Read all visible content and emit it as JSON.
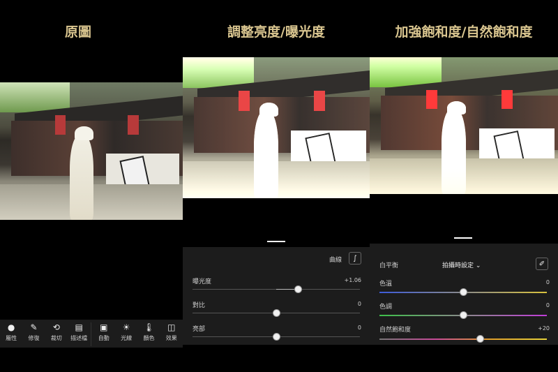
{
  "panels": [
    {
      "title": "原圖"
    },
    {
      "title": "調整亮度/曝光度"
    },
    {
      "title": "加強飽和度/自然飽和度"
    }
  ],
  "toolbar": {
    "items": [
      {
        "label": "屬性",
        "icon": "preset-icon"
      },
      {
        "label": "修復",
        "icon": "heal-icon"
      },
      {
        "label": "裁切",
        "icon": "crop-icon"
      },
      {
        "label": "描述檔",
        "icon": "profile-icon"
      },
      {
        "label": "自動",
        "icon": "auto-icon"
      },
      {
        "label": "光線",
        "icon": "light-icon"
      },
      {
        "label": "顏色",
        "icon": "color-icon"
      },
      {
        "label": "效果",
        "icon": "effects-icon"
      }
    ]
  },
  "light_panel": {
    "curve_label": "曲線",
    "sliders": [
      {
        "label": "曝光度",
        "value": "+1.06",
        "level": 0.63
      },
      {
        "label": "對比",
        "value": "0",
        "level": 0.5
      },
      {
        "label": "亮部",
        "value": "0",
        "level": 0.5
      }
    ]
  },
  "color_panel": {
    "wb_label": "白平衡",
    "wb_value": "拍攝時設定",
    "sliders": [
      {
        "label": "色溫",
        "value": "0",
        "level": 0.5
      },
      {
        "label": "色調",
        "value": "0",
        "level": 0.5
      },
      {
        "label": "自然飽和度",
        "value": "+20",
        "level": 0.6
      }
    ]
  }
}
